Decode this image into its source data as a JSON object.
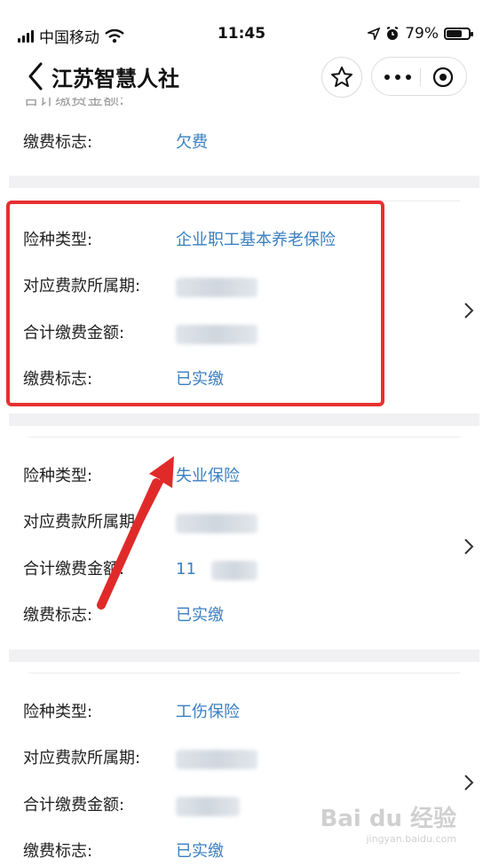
{
  "status_bar": {
    "carrier": "中国移动",
    "time": "11:45",
    "battery_percent": "79%",
    "battery_level": 0.79
  },
  "nav": {
    "title": "江苏智慧人社"
  },
  "cards": [
    {
      "rows": [
        {
          "label": "缴费标志:",
          "value": "欠费"
        }
      ]
    },
    {
      "rows": [
        {
          "label": "险种类型:",
          "value": "企业职工基本养老保险"
        },
        {
          "label": "对应费款所属期:",
          "value": ""
        },
        {
          "label": "合计缴费金额:",
          "value": ""
        },
        {
          "label": "缴费标志:",
          "value": "已实缴"
        }
      ]
    },
    {
      "rows": [
        {
          "label": "险种类型:",
          "value": "失业保险"
        },
        {
          "label": "对应费款所属期:",
          "value": ""
        },
        {
          "label": "合计缴费金额:",
          "value": "11"
        },
        {
          "label": "缴费标志:",
          "value": "已实缴"
        }
      ]
    },
    {
      "rows": [
        {
          "label": "险种类型:",
          "value": "工伤保险"
        },
        {
          "label": "对应费款所属期:",
          "value": ""
        },
        {
          "label": "合计缴费金额:",
          "value": ""
        },
        {
          "label": "缴费标志:",
          "value": "已实缴"
        }
      ]
    }
  ],
  "watermark": {
    "brand": "Bai du 经验",
    "url": "jingyan.baidu.com"
  },
  "colors": {
    "value_blue": "#3a7fc1",
    "highlight_red": "#e53030"
  },
  "icons": [
    "signal-icon",
    "wifi-icon",
    "location-icon",
    "alarm-icon",
    "battery-icon",
    "back-icon",
    "star-icon",
    "more-icon",
    "target-icon",
    "chevron-right-icon"
  ]
}
